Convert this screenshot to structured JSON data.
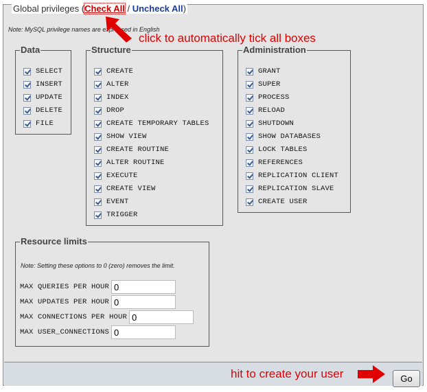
{
  "header": {
    "title": "Global privileges",
    "paren_open": "(",
    "check_all": "Check All",
    "separator": "/",
    "uncheck_all": "Uncheck All",
    "paren_close": ")",
    "note": "Note: MySQL privilege names are expressed in English"
  },
  "groups": {
    "data": {
      "legend": "Data",
      "items": [
        "SELECT",
        "INSERT",
        "UPDATE",
        "DELETE",
        "FILE"
      ]
    },
    "structure": {
      "legend": "Structure",
      "items": [
        "CREATE",
        "ALTER",
        "INDEX",
        "DROP",
        "CREATE TEMPORARY TABLES",
        "SHOW VIEW",
        "CREATE ROUTINE",
        "ALTER ROUTINE",
        "EXECUTE",
        "CREATE VIEW",
        "EVENT",
        "TRIGGER"
      ]
    },
    "administration": {
      "legend": "Administration",
      "items": [
        "GRANT",
        "SUPER",
        "PROCESS",
        "RELOAD",
        "SHUTDOWN",
        "SHOW DATABASES",
        "LOCK TABLES",
        "REFERENCES",
        "REPLICATION CLIENT",
        "REPLICATION SLAVE",
        "CREATE USER"
      ]
    }
  },
  "resources": {
    "legend": "Resource limits",
    "note": "Note: Setting these options to 0 (zero) removes the limit.",
    "rows": [
      {
        "label": "MAX QUERIES PER HOUR",
        "value": "0"
      },
      {
        "label": "MAX UPDATES PER HOUR",
        "value": "0"
      },
      {
        "label": "MAX CONNECTIONS PER HOUR",
        "value": "0"
      },
      {
        "label": "MAX USER_CONNECTIONS",
        "value": "0"
      }
    ]
  },
  "footer": {
    "go_label": "Go"
  },
  "annotations": {
    "check_all_hint": "click to automatically tick all boxes",
    "go_hint": "hit to create your user",
    "color": "#e00000"
  }
}
